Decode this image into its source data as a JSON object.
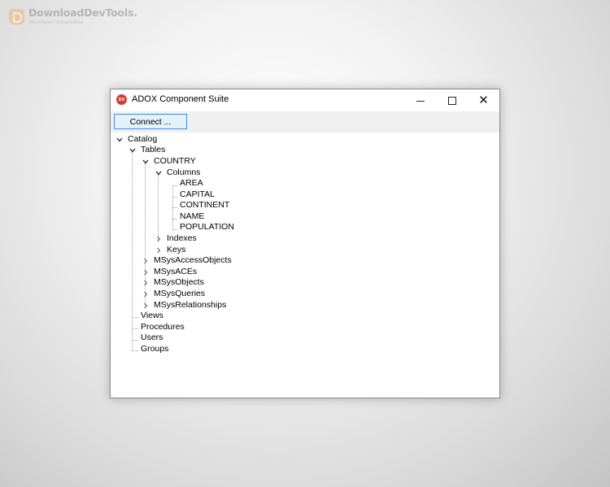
{
  "watermark": {
    "title": "DownloadDevTools.",
    "subtitle": "developer's paradise"
  },
  "window": {
    "title": "ADOX Component Suite",
    "app_icon_text": "DX",
    "controls": {
      "minimize": "minimize-icon",
      "maximize": "maximize-icon",
      "close": "close-icon"
    }
  },
  "toolbar": {
    "connect_label": "Connect ..."
  },
  "tree": {
    "catalog": "Catalog",
    "tables": "Tables",
    "country": "COUNTRY",
    "columns": "Columns",
    "column_items": [
      "AREA",
      "CAPITAL",
      "CONTINENT",
      "NAME",
      "POPULATION"
    ],
    "indexes": "Indexes",
    "keys": "Keys",
    "other_tables": [
      "MSysAccessObjects",
      "MSysACEs",
      "MSysObjects",
      "MSysQueries",
      "MSysRelationships"
    ],
    "views": "Views",
    "procedures": "Procedures",
    "users": "Users",
    "groups": "Groups"
  },
  "colors": {
    "accent": "#3d8ee0",
    "button_bg": "#e5f1fb",
    "toolbar_bg": "#f0f0f0",
    "app_icon": "#d83a32"
  }
}
